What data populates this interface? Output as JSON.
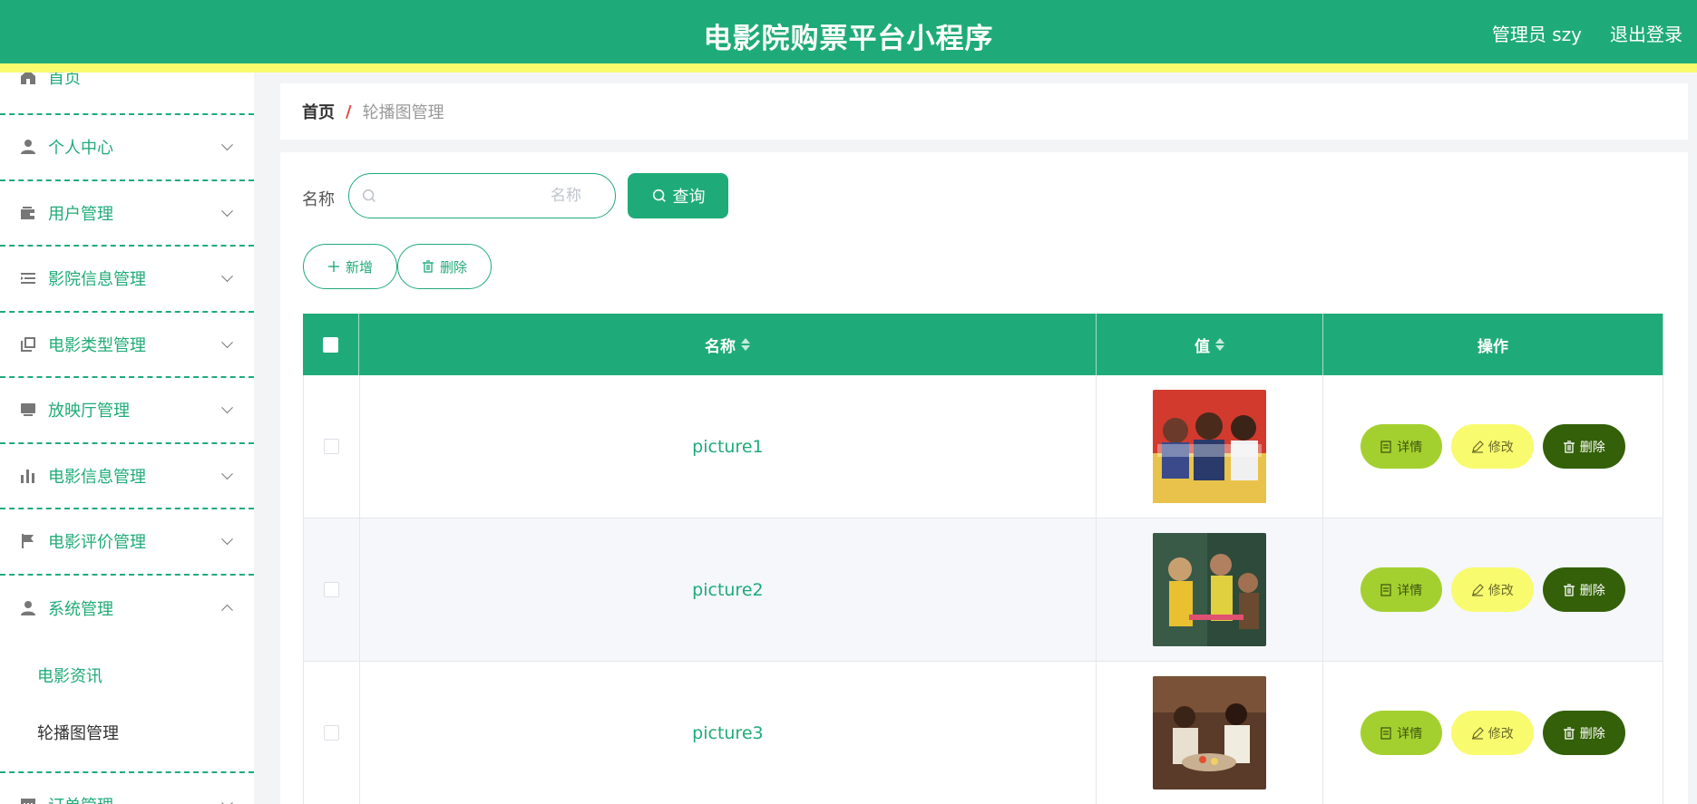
{
  "header": {
    "title": "电影院购票平台小程序",
    "user": "管理员 szy",
    "logout": "退出登录",
    "colors": {
      "primary": "#1fab79",
      "stripe": "#f8fb6e"
    }
  },
  "sidebar": {
    "items": [
      {
        "label": "首页",
        "icon": "home-icon"
      },
      {
        "label": "个人中心",
        "icon": "person-icon"
      },
      {
        "label": "用户管理",
        "icon": "wallet-icon"
      },
      {
        "label": "影院信息管理",
        "icon": "list-icon"
      },
      {
        "label": "电影类型管理",
        "icon": "copy-icon"
      },
      {
        "label": "放映厅管理",
        "icon": "monitor-icon"
      },
      {
        "label": "电影信息管理",
        "icon": "bar-chart-icon"
      },
      {
        "label": "电影评价管理",
        "icon": "flag-icon"
      },
      {
        "label": "系统管理",
        "icon": "person-icon",
        "expanded": true
      },
      {
        "label": "订单管理",
        "icon": "chat-icon"
      }
    ],
    "subitems": [
      {
        "label": "电影资讯"
      },
      {
        "label": "轮播图管理"
      }
    ]
  },
  "breadcrumb": {
    "home": "首页",
    "separator": "/",
    "current": "轮播图管理"
  },
  "search": {
    "label": "名称",
    "placeholder": "名称",
    "value": "",
    "button": "查询"
  },
  "actions": {
    "add": "新增",
    "delete": "删除"
  },
  "table": {
    "columns": [
      "名称",
      "值",
      "操作"
    ],
    "rows": [
      {
        "name": "picture1"
      },
      {
        "name": "picture2"
      },
      {
        "name": "picture3"
      }
    ],
    "row_actions": {
      "detail": "详情",
      "edit": "修改",
      "delete": "删除"
    }
  }
}
